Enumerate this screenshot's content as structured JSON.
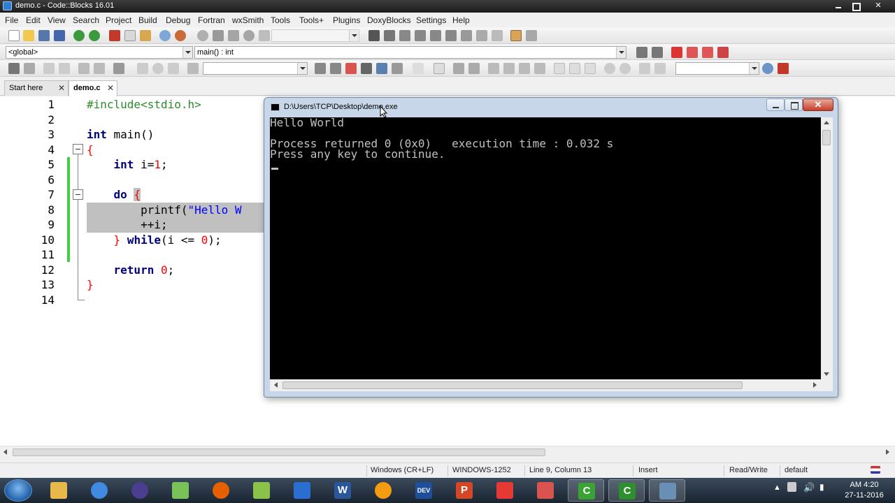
{
  "window": {
    "title": "demo.c - Code::Blocks 16.01"
  },
  "menu": [
    "File",
    "Edit",
    "View",
    "Search",
    "Project",
    "Build",
    "Debug",
    "Fortran",
    "wxSmith",
    "Tools",
    "Tools+",
    "Plugins",
    "DoxyBlocks",
    "Settings",
    "Help"
  ],
  "toolbar": {
    "scope": "<global>",
    "function": "main() : int"
  },
  "tabs": [
    {
      "label": "Start here"
    },
    {
      "label": "demo.c"
    }
  ],
  "editor": {
    "line_numbers": [
      "1",
      "2",
      "3",
      "4",
      "5",
      "6",
      "7",
      "8",
      "9",
      "10",
      "11",
      "12",
      "13",
      "14"
    ]
  },
  "console": {
    "title": "D:\\Users\\TCP\\Desktop\\demo.exe",
    "output": "Hello World\n\nProcess returned 0 (0x0)   execution time : 0.032 s\nPress any key to continue."
  },
  "status": {
    "eol": "Windows (CR+LF)",
    "encoding": "WINDOWS-1252",
    "position": "Line 9, Column 13",
    "mode": "Insert",
    "access": "Read/Write",
    "profile": "default"
  },
  "clock": {
    "time": "AM 4:20",
    "date": "27-11-2016"
  },
  "taskbar_apps": [
    {
      "name": "explorer",
      "color": "#e8b84a"
    },
    {
      "name": "chrome",
      "color": "#3e8be0"
    },
    {
      "name": "eclipse",
      "color": "#4b3d8f"
    },
    {
      "name": "android-studio",
      "color": "#78c257"
    },
    {
      "name": "firefox",
      "color": "#e66000"
    },
    {
      "name": "notepad-plus",
      "color": "#8bc34a"
    },
    {
      "name": "dolphin",
      "color": "#2a6fcf"
    },
    {
      "name": "word",
      "color": "#2b579a",
      "glyph": "W"
    },
    {
      "name": "media-player",
      "color": "#f39c12"
    },
    {
      "name": "dev-cpp",
      "color": "#1f4e9a",
      "glyph": "DEV"
    },
    {
      "name": "powerpoint",
      "color": "#d24726",
      "glyph": "P"
    },
    {
      "name": "office",
      "color": "#e53935"
    },
    {
      "name": "snipping-tool",
      "color": "#d9534f"
    },
    {
      "name": "codeblocks",
      "color": "#3aa335",
      "glyph": "C"
    },
    {
      "name": "codeblocks-2",
      "color": "#2e8f2e",
      "glyph": "C"
    },
    {
      "name": "console-app",
      "color": "#6a8fb5"
    }
  ]
}
